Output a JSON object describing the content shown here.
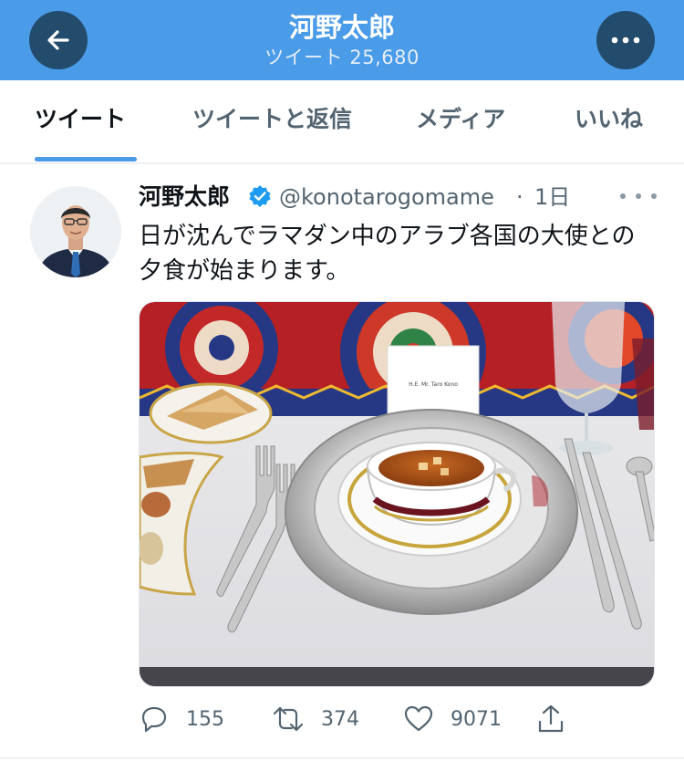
{
  "header": {
    "title": "河野太郎",
    "subtitle": "ツイート 25,680",
    "back_icon": "arrow-left-icon",
    "more_icon": "more-horizontal-icon",
    "color": "#4a9be8"
  },
  "tabs": [
    {
      "label": "ツイート",
      "active": true
    },
    {
      "label": "ツイートと返信",
      "active": false
    },
    {
      "label": "メディア",
      "active": false
    },
    {
      "label": "いいね",
      "active": false
    }
  ],
  "tweet": {
    "author_name": "河野太郎",
    "verified": true,
    "handle": "@konotarogomame",
    "separator": "·",
    "time": "1日",
    "text": "日が沈んでラマダン中のアラブ各国の大使との夕食が始まります。",
    "media_description_icon": "photo-dinner-table",
    "place_card_text": "H.E. Mr. Taro Kono"
  },
  "actions": {
    "reply_count": "155",
    "retweet_count": "374",
    "like_count": "9071"
  }
}
